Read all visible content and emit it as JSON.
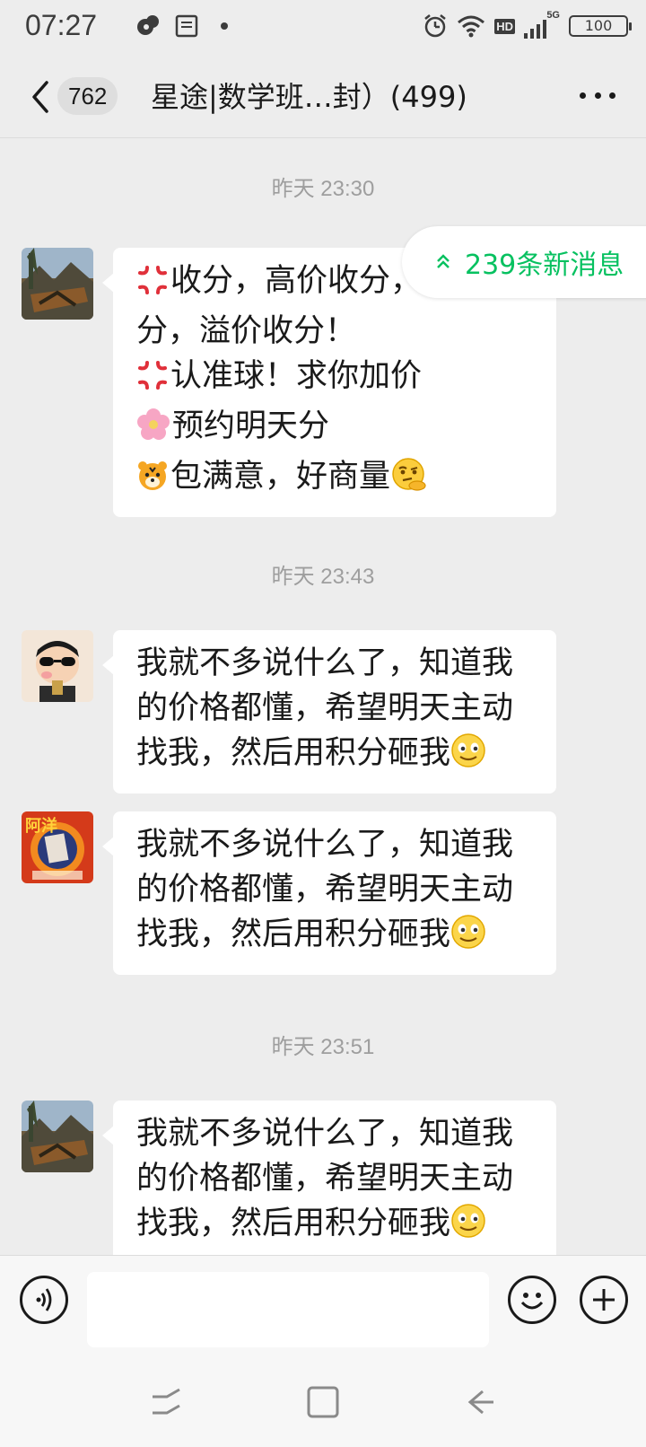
{
  "status_bar": {
    "time": "07:27",
    "network": "HD",
    "signal": "5G",
    "battery": "100"
  },
  "header": {
    "unread_count": "762",
    "title": "星途|数学班…封）(499)"
  },
  "new_messages_pill": {
    "label": "239条新消息"
  },
  "messages": [
    {
      "timestamp": "昨天 23:30",
      "avatar": "landscape-avatar",
      "lines": [
        {
          "emoji": "anger-symbol",
          "text": "收分，高价收分，溢价收"
        },
        {
          "emoji": "",
          "text": "分，溢价收分！"
        },
        {
          "emoji": "anger-symbol",
          "text": "认准球！求你加价"
        },
        {
          "emoji": "cherry-blossom",
          "text": "预约明天分"
        },
        {
          "emoji": "tiger-face",
          "text": "包满意，好商量",
          "trail_emoji": "thinking-face"
        }
      ]
    },
    {
      "timestamp": "昨天 23:43",
      "avatar": "cartoon-avatar",
      "lines": [
        {
          "emoji": "",
          "text": "我就不多说什么了，知道我"
        },
        {
          "emoji": "",
          "text": "的价格都懂，希望明天主动"
        },
        {
          "emoji": "",
          "text": "找我，然后用积分砸我",
          "trail_emoji": "smile-face"
        }
      ]
    },
    {
      "timestamp": "",
      "avatar": "red-poster-avatar",
      "avatar_text": "阿洋",
      "lines": [
        {
          "emoji": "",
          "text": "我就不多说什么了，知道我"
        },
        {
          "emoji": "",
          "text": "的价格都懂，希望明天主动"
        },
        {
          "emoji": "",
          "text": "找我，然后用积分砸我",
          "trail_emoji": "smile-face"
        }
      ]
    },
    {
      "timestamp": "昨天 23:51",
      "avatar": "landscape-avatar",
      "lines": [
        {
          "emoji": "",
          "text": "我就不多说什么了，知道我"
        },
        {
          "emoji": "",
          "text": "的价格都懂，希望明天主动"
        },
        {
          "emoji": "",
          "text": "找我，然后用积分砸我",
          "trail_emoji": "smile-face"
        }
      ]
    }
  ],
  "colors": {
    "background": "#ededed",
    "bubble": "#ffffff",
    "accent_green": "#07c160",
    "timestamp": "#9e9e9e"
  }
}
